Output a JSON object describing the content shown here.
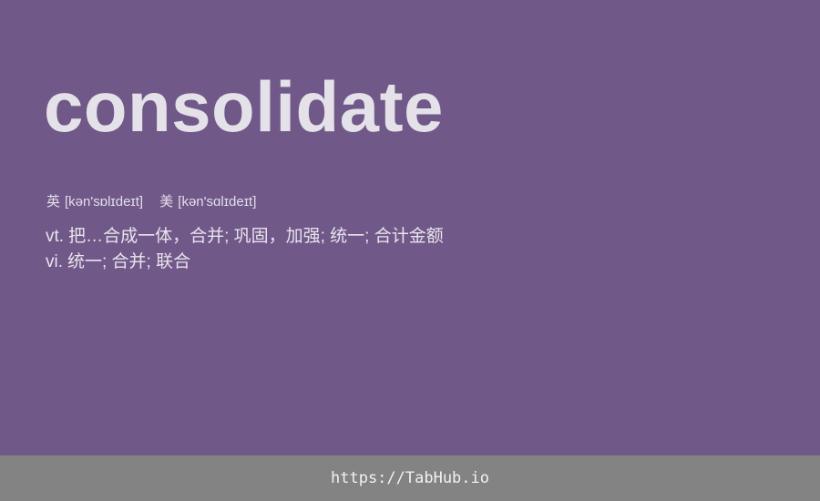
{
  "card": {
    "background_color": "#705889",
    "word": "consolidate",
    "phonetics": [
      {
        "label": "英",
        "ipa": "[kən'sɒlɪdeɪt]"
      },
      {
        "label": "美",
        "ipa": "[kən'sɑlɪdeɪt]"
      }
    ],
    "definitions": [
      {
        "pos": "vt.",
        "meaning": "把…合成一体，合并; 巩固，加强; 统一; 合计金额"
      },
      {
        "pos": "vi.",
        "meaning": "统一; 合并; 联合"
      }
    ]
  },
  "footer": {
    "background_color": "#838383",
    "link_text": "https://TabHub.io"
  }
}
